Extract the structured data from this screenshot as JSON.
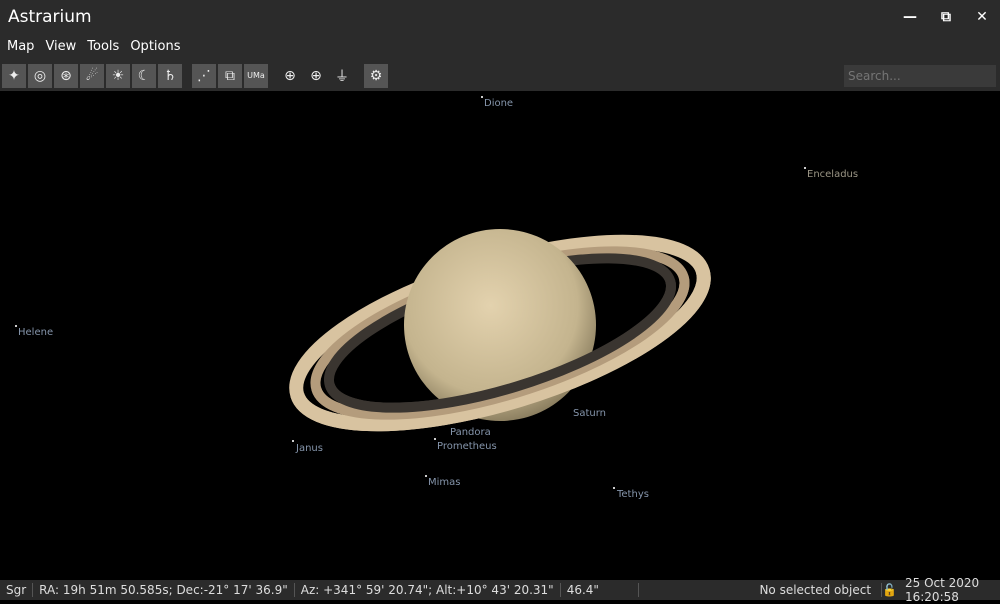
{
  "window": {
    "title": "Astrarium"
  },
  "menu": [
    "Map",
    "View",
    "Tools",
    "Options"
  ],
  "toolbar": {
    "buttons": [
      "stars-icon",
      "galaxy-icon",
      "star-cluster-icon",
      "comet-icon",
      "sun-icon",
      "moon-icon",
      "planet-icon",
      "constellation-lines-icon",
      "constellation-borders-icon",
      "constellation-labels-icon",
      "equatorial-grid-icon",
      "horizontal-grid-icon",
      "ground-icon",
      "settings-icon"
    ],
    "search_placeholder": "Search..."
  },
  "sky": {
    "labels": {
      "dione": "Dione",
      "enceladus": "Enceladus",
      "helene": "Helene",
      "saturn": "Saturn",
      "pandora": "Pandora",
      "prometheus": "Prometheus",
      "janus": "Janus",
      "mimas": "Mimas",
      "tethys": "Tethys"
    }
  },
  "status": {
    "constellation": "Sgr",
    "radec": "RA: 19h 51m 50.585s; Dec:-21° 17' 36.9\"",
    "azalt": "Az: +341° 59' 20.74\"; Alt:+10° 43' 20.31\"",
    "fov": "46.4\"",
    "selection": "No selected object",
    "datetime": "25 Oct 2020 16:20:58"
  }
}
